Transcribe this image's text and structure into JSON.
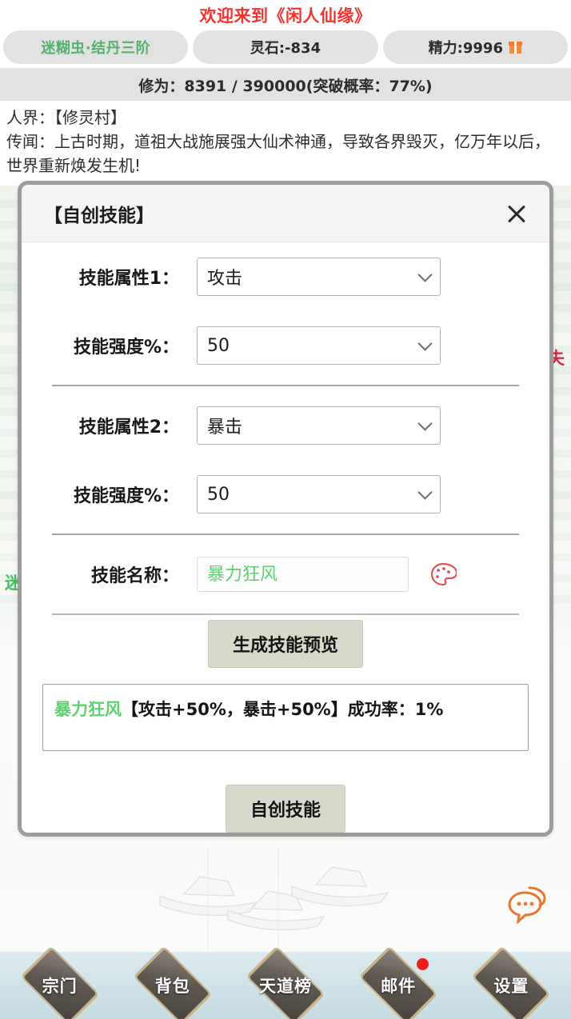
{
  "header": {
    "welcome": "欢迎来到《闲人仙缘》",
    "chips": [
      {
        "name": "rank",
        "text": "迷糊虫·结丹三阶",
        "color": "#56b06f",
        "icon": null
      },
      {
        "name": "spirit-stone",
        "text": "灵石:-834",
        "color": "#2b2b2b",
        "icon": null
      },
      {
        "name": "energy",
        "text": "精力:9996",
        "color": "#2b2b2b",
        "icon": "gift-icon"
      }
    ],
    "cultivation": "修为：8391 / 390000(突破概率：77%)"
  },
  "story": {
    "location": "人界：【修灵村】",
    "lore": "传闻：上古时期，道祖大战施展强大仙术神通，导致各界毁灭，亿万年以后，世界重新焕发生机!"
  },
  "background_glyphs": {
    "left": "迷",
    "right": "失"
  },
  "modal": {
    "title": "【自创技能】",
    "close_icon": "close-icon",
    "rows": [
      {
        "label": "技能属性1：",
        "value": "攻击"
      },
      {
        "label": "技能强度%：",
        "value": "50"
      },
      {
        "label": "技能属性2：",
        "value": "暴击"
      },
      {
        "label": "技能强度%：",
        "value": "50"
      }
    ],
    "name_row": {
      "label": "技能名称：",
      "value": "暴力狂风",
      "placeholder": "暴力狂风",
      "palette_icon": "palette-icon"
    },
    "preview_button": "生成技能预览",
    "preview": {
      "skill_name": "暴力狂风",
      "detail": "【攻击+50%，暴击+50%】成功率：1%"
    },
    "create_button": "自创技能"
  },
  "chat": {
    "icon": "chat-bubble-icon"
  },
  "bottom_nav": [
    {
      "label": "宗门",
      "badge": false
    },
    {
      "label": "背包",
      "badge": false
    },
    {
      "label": "天道榜",
      "badge": false
    },
    {
      "label": "邮件",
      "badge": true
    },
    {
      "label": "设置",
      "badge": false
    }
  ]
}
